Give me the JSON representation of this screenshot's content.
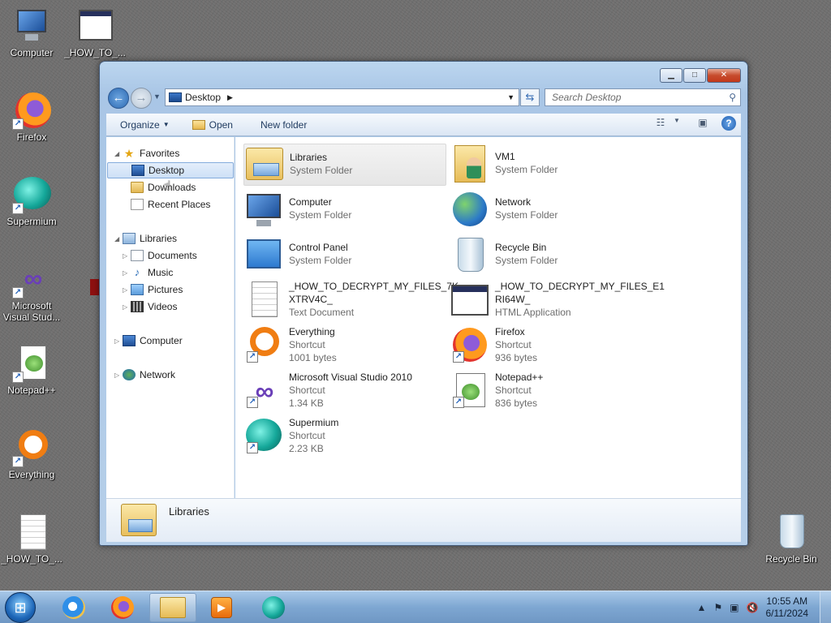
{
  "desktop": {
    "icons": [
      {
        "label": "Computer",
        "icon": "computer-icon"
      },
      {
        "label": "_HOW_TO_...",
        "icon": "hta-file-icon"
      },
      {
        "label": "Firefox",
        "icon": "firefox-icon"
      },
      {
        "label": "Supermium",
        "icon": "supermium-icon"
      },
      {
        "label": "Microsoft Visual Stud...",
        "icon": "visual-studio-icon"
      },
      {
        "label": "Notepad++",
        "icon": "notepad-plus-plus-icon"
      },
      {
        "label": "Everything",
        "icon": "everything-icon"
      },
      {
        "label": "_HOW_TO_...",
        "icon": "text-file-icon"
      },
      {
        "label": "Recycle Bin",
        "icon": "recycle-bin-icon"
      }
    ]
  },
  "window": {
    "address": {
      "location": "Desktop",
      "search_placeholder": "Search Desktop"
    },
    "toolbar": {
      "organize": "Organize",
      "open": "Open",
      "new_folder": "New folder"
    },
    "nav": {
      "favorites": "Favorites",
      "desktop": "Desktop",
      "downloads": "Downloads",
      "recent": "Recent Places",
      "libraries": "Libraries",
      "documents": "Documents",
      "music": "Music",
      "pictures": "Pictures",
      "videos": "Videos",
      "computer": "Computer",
      "network": "Network"
    },
    "items": [
      {
        "name": "Libraries",
        "sub1": "System Folder",
        "sub2": ""
      },
      {
        "name": "VM1",
        "sub1": "System Folder",
        "sub2": ""
      },
      {
        "name": "Computer",
        "sub1": "System Folder",
        "sub2": ""
      },
      {
        "name": "Network",
        "sub1": "System Folder",
        "sub2": ""
      },
      {
        "name": "Control Panel",
        "sub1": "System Folder",
        "sub2": ""
      },
      {
        "name": "Recycle Bin",
        "sub1": "System Folder",
        "sub2": ""
      },
      {
        "name": "_HOW_TO_DECRYPT_MY_FILES_7K",
        "name2": "XTRV4C_",
        "sub1": "Text Document",
        "sub2": ""
      },
      {
        "name": "_HOW_TO_DECRYPT_MY_FILES_E1",
        "name2": "RI64W_",
        "sub1": "HTML Application",
        "sub2": ""
      },
      {
        "name": "Everything",
        "sub1": "Shortcut",
        "sub2": "1001 bytes"
      },
      {
        "name": "Firefox",
        "sub1": "Shortcut",
        "sub2": "936 bytes"
      },
      {
        "name": "Microsoft Visual Studio 2010",
        "sub1": "Shortcut",
        "sub2": "1.34 KB"
      },
      {
        "name": "Notepad++",
        "sub1": "Shortcut",
        "sub2": "836 bytes"
      },
      {
        "name": "Supermium",
        "sub1": "Shortcut",
        "sub2": "2.23 KB"
      }
    ],
    "details": {
      "name": "Libraries"
    }
  },
  "taskbar": {
    "clock_time": "10:55 AM",
    "clock_date": "6/11/2024"
  },
  "colors": {
    "accent": "#3a70b6",
    "selection": "#cde0f6"
  }
}
